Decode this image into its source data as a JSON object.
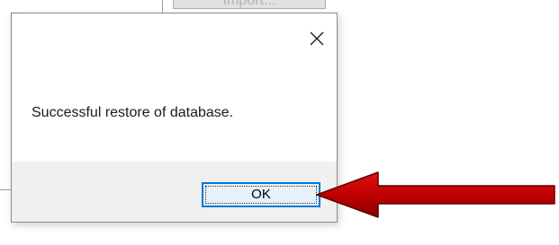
{
  "background": {
    "import_button_label": "Import..."
  },
  "dialog": {
    "message": "Successful restore of database.",
    "ok_label": "OK",
    "close_icon": "close-icon"
  },
  "annotation": {
    "arrow_color": "#c00000",
    "arrow_direction": "left"
  }
}
